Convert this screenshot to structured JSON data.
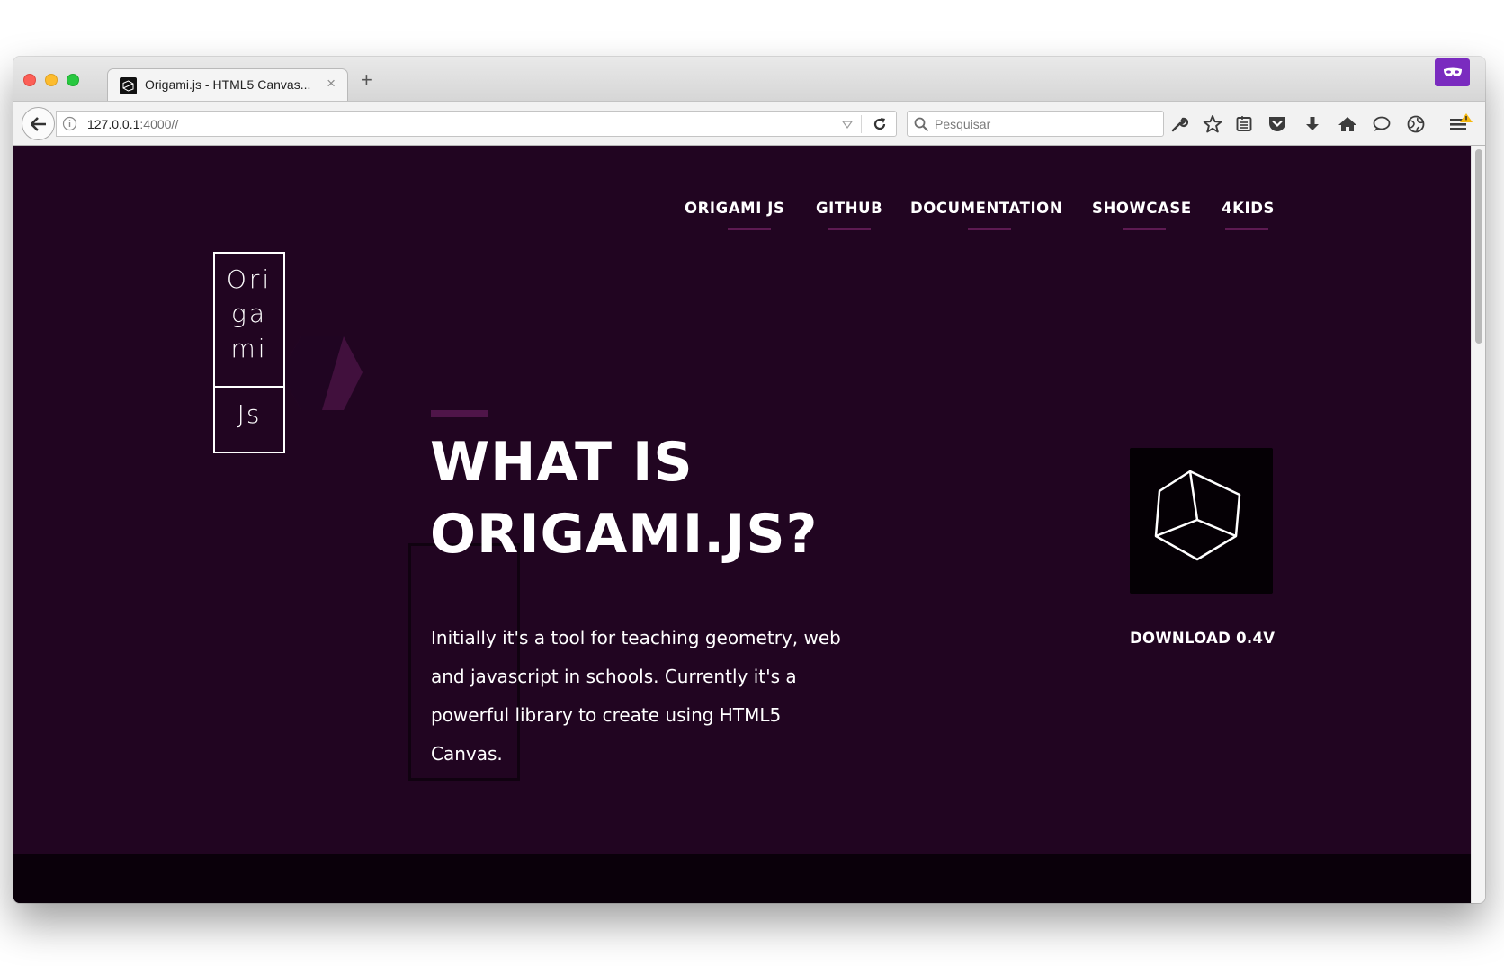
{
  "browser": {
    "tab": {
      "title": "Origami.js - HTML5 Canvas...",
      "close": "×"
    },
    "new_tab": "+",
    "url": {
      "host": "127.0.0.1",
      "rest": ":4000//"
    },
    "search": {
      "placeholder": "Pesquisar"
    },
    "toolbar_icons": [
      "wrench-icon",
      "star-icon",
      "reading-list-icon",
      "pocket-icon",
      "download-icon",
      "home-icon",
      "chat-icon",
      "globe-icon",
      "menu-icon"
    ]
  },
  "site": {
    "nav": [
      {
        "label": "ORIGAMI JS"
      },
      {
        "label": "GITHUB"
      },
      {
        "label": "DOCUMENTATION"
      },
      {
        "label": "SHOWCASE"
      },
      {
        "label": "4KIDS"
      }
    ],
    "logo": {
      "lines": [
        "Ori",
        "ga",
        "mi"
      ],
      "suffix": "Js"
    },
    "heading": {
      "line1": "WHAT IS",
      "line2": "ORIGAMI.JS?"
    },
    "intro": "Initially it's a tool for teaching geometry, web and javascript in schools. Currently it's a powerful library to create using HTML5 Canvas.",
    "download": {
      "label": "DOWNLOAD 0.4V"
    },
    "colors": {
      "background": "#210521",
      "accent": "#4f1549",
      "nav_underline": "#5d1a52",
      "footer": "#0a000a",
      "mask_button": "#7a2bbf"
    }
  }
}
